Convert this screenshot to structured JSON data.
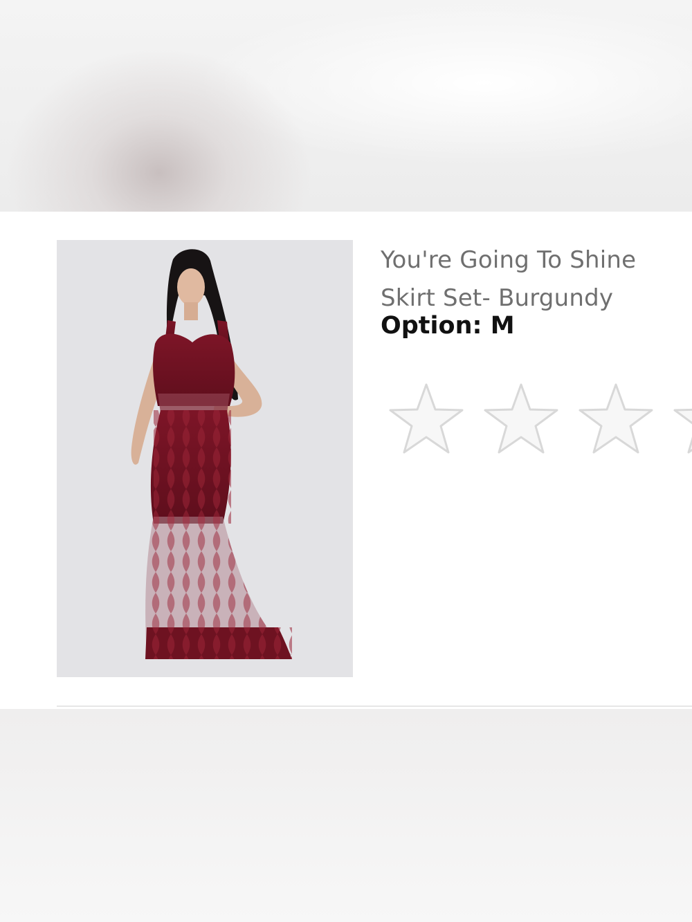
{
  "product": {
    "title_line1": "You're Going To Shine",
    "title_line2": "Skirt Set- Burgundy",
    "option_label": "Option:",
    "option_value": "M",
    "image_icon": "product-photo-burgundy-lace-maxi-dress",
    "dress_color": "#7a1426"
  },
  "rating": {
    "value": 0,
    "max": 5,
    "star_icon": "star-outline-icon",
    "star_outline_color": "#d8d8d8",
    "star_fill_color": "#f7f7f7"
  }
}
